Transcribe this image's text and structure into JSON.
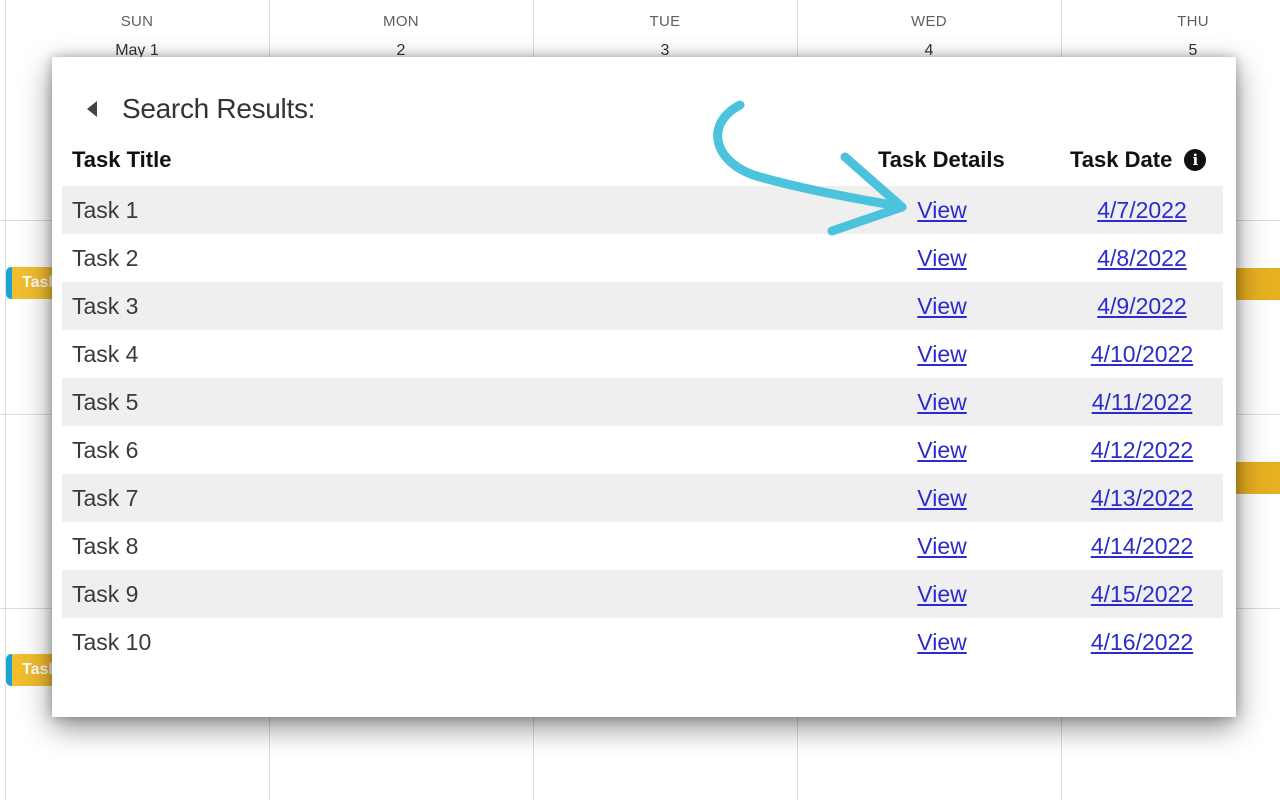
{
  "calendar": {
    "days": [
      {
        "name": "SUN",
        "num": "May 1"
      },
      {
        "name": "MON",
        "num": "2"
      },
      {
        "name": "TUE",
        "num": "3"
      },
      {
        "name": "WED",
        "num": "4"
      },
      {
        "name": "THU",
        "num": "5"
      }
    ],
    "events": [
      "Task",
      "Task"
    ]
  },
  "modal": {
    "title": "Search Results:",
    "columns": {
      "title": "Task Title",
      "details": "Task Details",
      "date": "Task Date"
    },
    "info_icon": "info-icon",
    "rows": [
      {
        "title": "Task 1",
        "view": "View",
        "date": "4/7/2022"
      },
      {
        "title": "Task 2",
        "view": "View",
        "date": "4/8/2022"
      },
      {
        "title": "Task 3",
        "view": "View",
        "date": "4/9/2022"
      },
      {
        "title": "Task 4",
        "view": "View",
        "date": "4/10/2022"
      },
      {
        "title": "Task 5",
        "view": "View",
        "date": "4/11/2022"
      },
      {
        "title": "Task 6",
        "view": "View",
        "date": "4/12/2022"
      },
      {
        "title": "Task 7",
        "view": "View",
        "date": "4/13/2022"
      },
      {
        "title": "Task 8",
        "view": "View",
        "date": "4/14/2022"
      },
      {
        "title": "Task 9",
        "view": "View",
        "date": "4/15/2022"
      },
      {
        "title": "Task 10",
        "view": "View",
        "date": "4/16/2022"
      }
    ]
  },
  "colors": {
    "link": "#2b2bcf",
    "row_shade": "#efefef",
    "event_bg": "#f2be2e",
    "event_accent": "#1aa3d9",
    "annotation_arrow": "#4cc3dc"
  }
}
